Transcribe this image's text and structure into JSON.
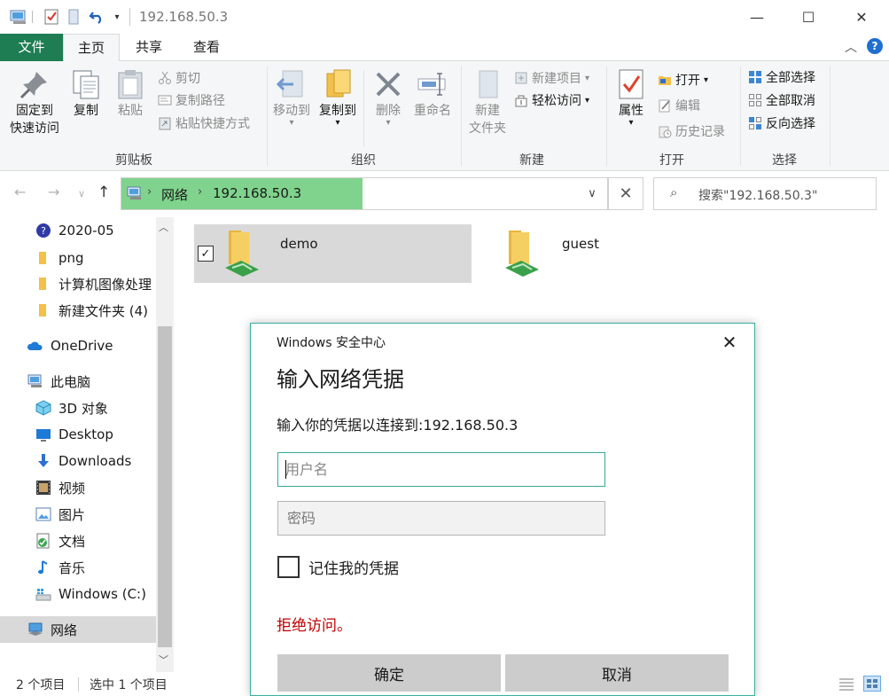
{
  "window": {
    "title": "192.168.50.3",
    "minimize": "—",
    "maximize": "☐",
    "close": "✕"
  },
  "ribbon_tabs": [
    "文件",
    "主页",
    "共享",
    "查看"
  ],
  "ribbon": {
    "clipboard": {
      "label": "剪贴板",
      "pin": [
        "固定到",
        "快速访问"
      ],
      "copy": "复制",
      "paste": "粘贴",
      "cut": "剪切",
      "copy_path": "复制路径",
      "paste_shortcut": "粘贴快捷方式"
    },
    "organize": {
      "label": "组织",
      "move_to": "移动到",
      "copy_to": "复制到",
      "delete": "删除",
      "rename": "重命名"
    },
    "new": {
      "label": "新建",
      "new_folder": [
        "新建",
        "文件夹"
      ],
      "new_item": "新建项目",
      "easy_access": "轻松访问"
    },
    "open": {
      "label": "打开",
      "properties": "属性",
      "open": "打开",
      "edit": "编辑",
      "history": "历史记录"
    },
    "select": {
      "label": "选择",
      "select_all": "全部选择",
      "select_none": "全部取消",
      "invert": "反向选择"
    }
  },
  "address": {
    "crumbs": [
      "网络",
      "192.168.50.3"
    ],
    "search_placeholder": "搜索\"192.168.50.3\""
  },
  "nav_pane": {
    "items": [
      {
        "label": "2020-05",
        "icon": "help-icon"
      },
      {
        "label": "png",
        "icon": "folder-icon"
      },
      {
        "label": "计算机图像处理",
        "icon": "folder-icon"
      },
      {
        "label": "新建文件夹 (4)",
        "icon": "folder-icon"
      },
      {
        "label": "OneDrive",
        "icon": "cloud-icon"
      },
      {
        "label": "此电脑",
        "icon": "computer-icon"
      },
      {
        "label": "3D 对象",
        "icon": "cube-icon"
      },
      {
        "label": "Desktop",
        "icon": "desktop-icon"
      },
      {
        "label": "Downloads",
        "icon": "download-icon"
      },
      {
        "label": "视频",
        "icon": "video-icon"
      },
      {
        "label": "图片",
        "icon": "picture-icon"
      },
      {
        "label": "文档",
        "icon": "document-icon"
      },
      {
        "label": "音乐",
        "icon": "music-icon"
      },
      {
        "label": "Windows (C:)",
        "icon": "drive-icon"
      },
      {
        "label": "网络",
        "icon": "network-icon"
      }
    ]
  },
  "content": {
    "items": [
      {
        "label": "demo",
        "selected": true,
        "checked": true
      },
      {
        "label": "guest",
        "selected": false,
        "checked": false
      }
    ]
  },
  "status": {
    "count": "2 个项目",
    "selected": "选中 1 个项目"
  },
  "dialog": {
    "title": "Windows 安全中心",
    "heading": "输入网络凭据",
    "message": "输入你的凭据以连接到:192.168.50.3",
    "username_placeholder": "用户名",
    "password_placeholder": "密码",
    "remember_label": "记住我的凭据",
    "error": "拒绝访问。",
    "ok": "确定",
    "cancel": "取消"
  },
  "colors": {
    "file_tab": "#1e7d52",
    "address_highlight": "#7fd38d",
    "dialog_border": "#38b0a0",
    "error": "#c00000",
    "folder": "#f3c04a"
  }
}
